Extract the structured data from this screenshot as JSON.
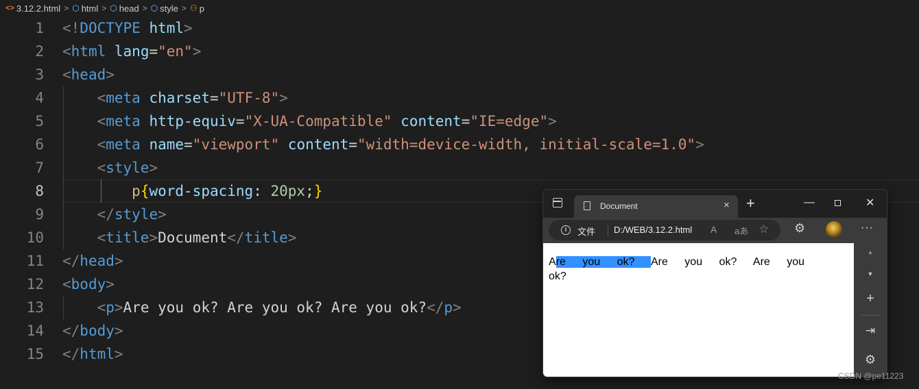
{
  "breadcrumb": {
    "file": "3.12.2.html",
    "items": [
      "html",
      "head",
      "style",
      "p"
    ],
    "separator": ">",
    "file_icon": "<>"
  },
  "code": {
    "line_numbers": [
      "1",
      "2",
      "3",
      "4",
      "5",
      "6",
      "7",
      "8",
      "9",
      "10",
      "11",
      "12",
      "13",
      "14",
      "15"
    ],
    "active_line": "8",
    "lines": [
      [
        [
          "br",
          "<!"
        ],
        [
          "tag",
          "DOCTYPE"
        ],
        [
          "txt",
          " "
        ],
        [
          "attr",
          "html"
        ],
        [
          "br",
          ">"
        ]
      ],
      [
        [
          "br",
          "<"
        ],
        [
          "tag",
          "html"
        ],
        [
          "txt",
          " "
        ],
        [
          "attr",
          "lang"
        ],
        [
          "txt",
          "="
        ],
        [
          "str",
          "\"en\""
        ],
        [
          "br",
          ">"
        ]
      ],
      [
        [
          "br",
          "<"
        ],
        [
          "tag",
          "head"
        ],
        [
          "br",
          ">"
        ]
      ],
      [
        [
          "txt",
          "    "
        ],
        [
          "br",
          "<"
        ],
        [
          "tag",
          "meta"
        ],
        [
          "txt",
          " "
        ],
        [
          "attr",
          "charset"
        ],
        [
          "txt",
          "="
        ],
        [
          "str",
          "\"UTF-8\""
        ],
        [
          "br",
          ">"
        ]
      ],
      [
        [
          "txt",
          "    "
        ],
        [
          "br",
          "<"
        ],
        [
          "tag",
          "meta"
        ],
        [
          "txt",
          " "
        ],
        [
          "attr",
          "http-equiv"
        ],
        [
          "txt",
          "="
        ],
        [
          "str",
          "\"X-UA-Compatible\""
        ],
        [
          "txt",
          " "
        ],
        [
          "attr",
          "content"
        ],
        [
          "txt",
          "="
        ],
        [
          "str",
          "\"IE=edge\""
        ],
        [
          "br",
          ">"
        ]
      ],
      [
        [
          "txt",
          "    "
        ],
        [
          "br",
          "<"
        ],
        [
          "tag",
          "meta"
        ],
        [
          "txt",
          " "
        ],
        [
          "attr",
          "name"
        ],
        [
          "txt",
          "="
        ],
        [
          "str",
          "\"viewport\""
        ],
        [
          "txt",
          " "
        ],
        [
          "attr",
          "content"
        ],
        [
          "txt",
          "="
        ],
        [
          "str",
          "\"width=device-width, initial-scale=1.0\""
        ],
        [
          "br",
          ">"
        ]
      ],
      [
        [
          "txt",
          "    "
        ],
        [
          "br",
          "<"
        ],
        [
          "tag",
          "style"
        ],
        [
          "br",
          ">"
        ]
      ],
      [
        [
          "txt",
          "        "
        ],
        [
          "sel",
          "p"
        ],
        [
          "brace",
          "{"
        ],
        [
          "attr",
          "word-spacing"
        ],
        [
          "txt",
          ": "
        ],
        [
          "num",
          "20px"
        ],
        [
          "txt",
          ";"
        ],
        [
          "brace",
          "}"
        ]
      ],
      [
        [
          "txt",
          "    "
        ],
        [
          "br",
          "</"
        ],
        [
          "tag",
          "style"
        ],
        [
          "br",
          ">"
        ]
      ],
      [
        [
          "txt",
          "    "
        ],
        [
          "br",
          "<"
        ],
        [
          "tag",
          "title"
        ],
        [
          "br",
          ">"
        ],
        [
          "txt",
          "Document"
        ],
        [
          "br",
          "</"
        ],
        [
          "tag",
          "title"
        ],
        [
          "br",
          ">"
        ]
      ],
      [
        [
          "br",
          "</"
        ],
        [
          "tag",
          "head"
        ],
        [
          "br",
          ">"
        ]
      ],
      [
        [
          "br",
          "<"
        ],
        [
          "tag",
          "body"
        ],
        [
          "br",
          ">"
        ]
      ],
      [
        [
          "txt",
          "    "
        ],
        [
          "br",
          "<"
        ],
        [
          "tag",
          "p"
        ],
        [
          "br",
          ">"
        ],
        [
          "txt",
          "Are you ok? Are you ok? Are you ok?"
        ],
        [
          "br",
          "</"
        ],
        [
          "tag",
          "p"
        ],
        [
          "br",
          ">"
        ]
      ],
      [
        [
          "br",
          "</"
        ],
        [
          "tag",
          "body"
        ],
        [
          "br",
          ">"
        ]
      ],
      [
        [
          "br",
          "</"
        ],
        [
          "tag",
          "html"
        ],
        [
          "br",
          ">"
        ]
      ]
    ]
  },
  "browser": {
    "tab_title": "Document",
    "tab_close": "×",
    "new_tab": "+",
    "window_controls": {
      "minimize": "—",
      "close": "✕"
    },
    "address": {
      "info": "i",
      "label": "文件",
      "url": "D:/WEB/3.12.2.html"
    },
    "toolbar_icons": {
      "read_aloud": "A",
      "translate": "aあ",
      "favorite": "☆",
      "extensions": "⚙",
      "more": "···"
    },
    "page": {
      "selected_prefix": "A",
      "selected_text": "re you ok? ",
      "rest_text": "Are you ok? Are you ok?"
    },
    "sidebar": {
      "up": "▲",
      "down": "▼",
      "add": "+",
      "exit": "⇥",
      "settings": "⚙"
    }
  },
  "watermark": "CSDN @pe11223",
  "colors": {
    "editor_bg": "#1e1e1e",
    "tag": "#569cd6",
    "attr": "#9cdcfe",
    "string": "#ce9178",
    "selector": "#d7ba7d",
    "brace": "#ffd700",
    "number": "#b5cea8",
    "selection": "#3390ff"
  }
}
